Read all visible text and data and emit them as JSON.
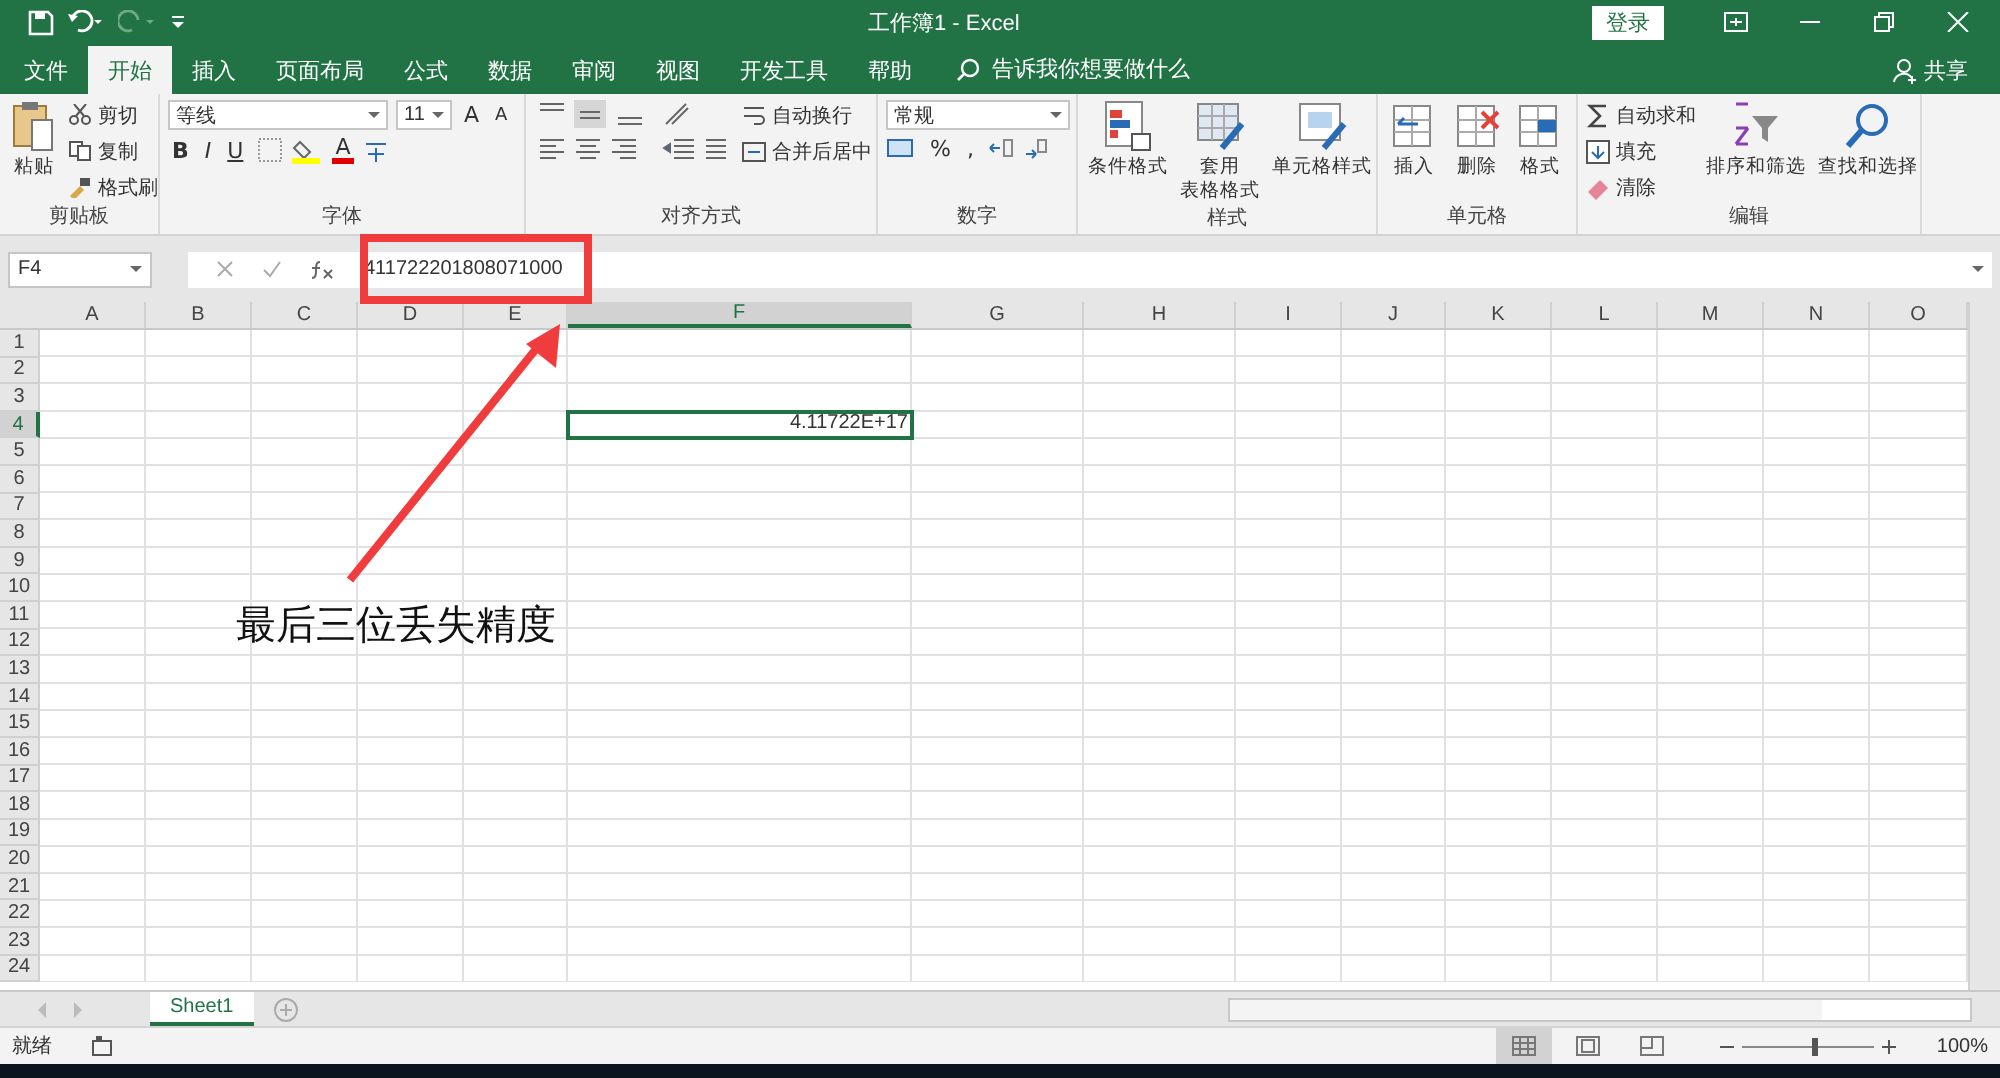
{
  "window": {
    "title": "工作簿1 - Excel",
    "login_button": "登录"
  },
  "ribbon_tabs": [
    {
      "label": "文件",
      "selected": false
    },
    {
      "label": "开始",
      "selected": true
    },
    {
      "label": "插入",
      "selected": false
    },
    {
      "label": "页面布局",
      "selected": false
    },
    {
      "label": "公式",
      "selected": false
    },
    {
      "label": "数据",
      "selected": false
    },
    {
      "label": "审阅",
      "selected": false
    },
    {
      "label": "视图",
      "selected": false
    },
    {
      "label": "开发工具",
      "selected": false
    },
    {
      "label": "帮助",
      "selected": false
    }
  ],
  "tell_me": {
    "placeholder": "告诉我你想要做什么"
  },
  "share_button": "共享",
  "ribbon": {
    "clipboard": {
      "label": "剪贴板",
      "paste": "粘贴",
      "items": [
        {
          "kind": "cut",
          "label": "剪切"
        },
        {
          "kind": "copy",
          "label": "复制"
        },
        {
          "kind": "painter",
          "label": "格式刷"
        }
      ]
    },
    "font": {
      "label": "字体",
      "font_name": "等线",
      "font_size": "11",
      "grow": "A",
      "shrink": "A",
      "styles": [
        {
          "kind": "bold",
          "label": "B"
        },
        {
          "kind": "italic",
          "label": "I"
        },
        {
          "kind": "underline",
          "label": "U"
        }
      ],
      "font_color": "A"
    },
    "alignment": {
      "label": "对齐方式",
      "wrap": "自动换行",
      "merge": "合并后居中"
    },
    "number": {
      "label": "数字",
      "format": "常规",
      "percent": "%",
      "comma": ","
    },
    "styles": {
      "label": "样式",
      "items": [
        {
          "kind": "conditional",
          "lines": [
            "条件格式"
          ]
        },
        {
          "kind": "table",
          "lines": [
            "套用",
            "表格格式"
          ]
        },
        {
          "kind": "cellstyle",
          "lines": [
            "单元格样式"
          ]
        }
      ]
    },
    "cells": {
      "label": "单元格",
      "items": [
        {
          "kind": "insert",
          "label": "插入"
        },
        {
          "kind": "delete",
          "label": "删除"
        },
        {
          "kind": "format",
          "label": "格式"
        }
      ]
    },
    "editing": {
      "label": "编辑",
      "items": [
        {
          "kind": "sum",
          "label": "自动求和"
        },
        {
          "kind": "fill",
          "label": "填充"
        },
        {
          "kind": "clear",
          "label": "清除"
        }
      ],
      "big": [
        {
          "kind": "sort",
          "label": "排序和筛选"
        },
        {
          "kind": "find",
          "label": "查找和选择"
        }
      ]
    }
  },
  "formula_bar": {
    "name_box": "F4",
    "formula": "411722201808071000"
  },
  "sheet": {
    "columns": [
      {
        "label": "A",
        "selected": false
      },
      {
        "label": "B",
        "selected": false
      },
      {
        "label": "C",
        "selected": false
      },
      {
        "label": "D",
        "selected": false
      },
      {
        "label": "E",
        "selected": false
      },
      {
        "label": "F",
        "selected": true
      },
      {
        "label": "G",
        "selected": false
      },
      {
        "label": "H",
        "selected": false
      },
      {
        "label": "I",
        "selected": false
      },
      {
        "label": "J",
        "selected": false
      },
      {
        "label": "K",
        "selected": false
      },
      {
        "label": "L",
        "selected": false
      },
      {
        "label": "M",
        "selected": false
      },
      {
        "label": "N",
        "selected": false
      },
      {
        "label": "O",
        "selected": false
      }
    ],
    "rows": [
      {
        "label": "1",
        "selected": false
      },
      {
        "label": "2",
        "selected": false
      },
      {
        "label": "3",
        "selected": false
      },
      {
        "label": "4",
        "selected": true,
        "cells": [
          null,
          null,
          null,
          null,
          null,
          {
            "value": "4.11722E+17",
            "selected": true
          },
          null,
          null,
          null,
          null,
          null,
          null,
          null,
          null,
          null
        ]
      },
      {
        "label": "5",
        "selected": false
      },
      {
        "label": "6",
        "selected": false
      },
      {
        "label": "7",
        "selected": false
      },
      {
        "label": "8",
        "selected": false
      },
      {
        "label": "9",
        "selected": false
      },
      {
        "label": "10",
        "selected": false
      },
      {
        "label": "11",
        "selected": false
      },
      {
        "label": "12",
        "selected": false
      },
      {
        "label": "13",
        "selected": false
      },
      {
        "label": "14",
        "selected": false
      },
      {
        "label": "15",
        "selected": false
      },
      {
        "label": "16",
        "selected": false
      },
      {
        "label": "17",
        "selected": false
      },
      {
        "label": "18",
        "selected": false
      },
      {
        "label": "19",
        "selected": false
      },
      {
        "label": "20",
        "selected": false
      },
      {
        "label": "21",
        "selected": false
      },
      {
        "label": "22",
        "selected": false
      },
      {
        "label": "23",
        "selected": false
      },
      {
        "label": "24",
        "selected": false
      }
    ]
  },
  "sheet_tabs": [
    {
      "label": "Sheet1",
      "selected": true
    }
  ],
  "status_bar": {
    "status": "就绪",
    "views": [
      {
        "kind": "normal",
        "selected": true
      },
      {
        "kind": "layout",
        "selected": false
      },
      {
        "kind": "pagebreak",
        "selected": false
      }
    ],
    "zoom": {
      "level": 0.52,
      "reading": "100%"
    }
  },
  "annotation": {
    "text": "最后三位丢失精度"
  }
}
